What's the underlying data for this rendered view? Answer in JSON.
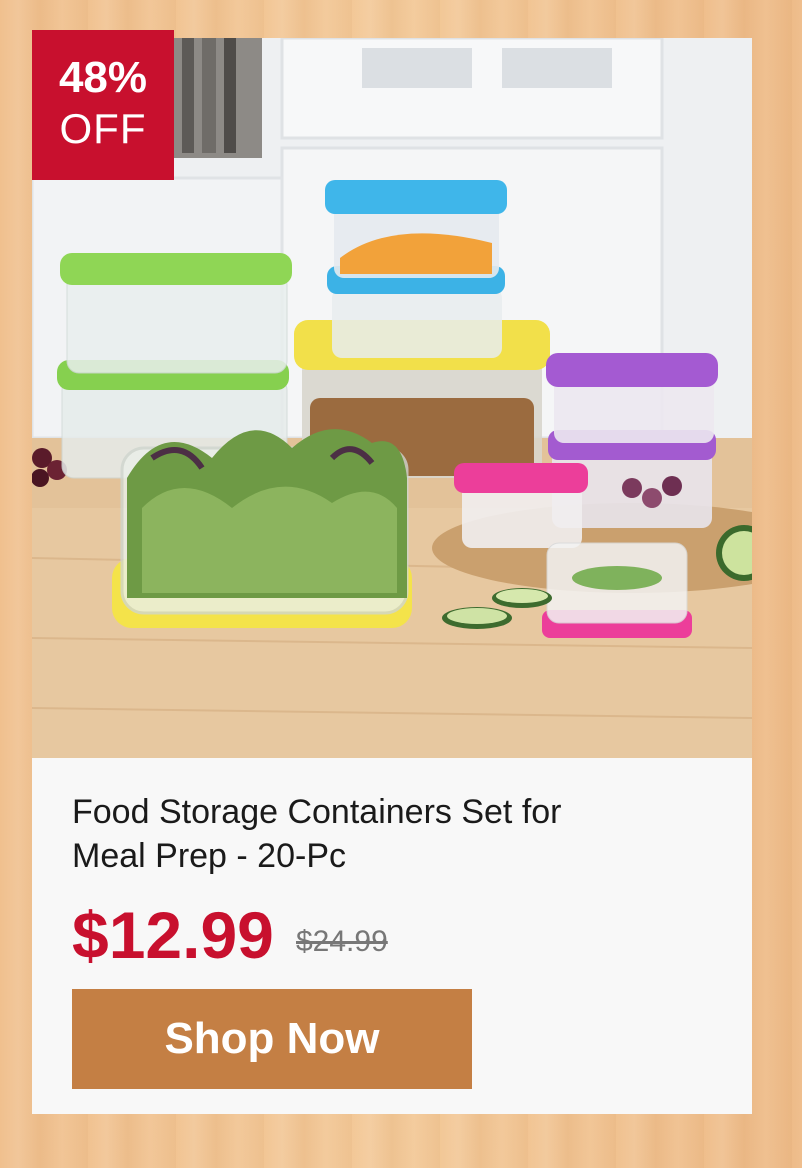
{
  "badge": {
    "percent": "48%",
    "off": "OFF"
  },
  "product": {
    "title": "Food Storage Containers Set for Meal Prep - 20-Pc",
    "price": "$12.99",
    "original_price": "$24.99"
  },
  "cta": {
    "label": "Shop Now"
  },
  "colors": {
    "badge": "#c8102e",
    "price": "#c8102e",
    "button": "#c47f44",
    "background": "#f1c28f"
  }
}
